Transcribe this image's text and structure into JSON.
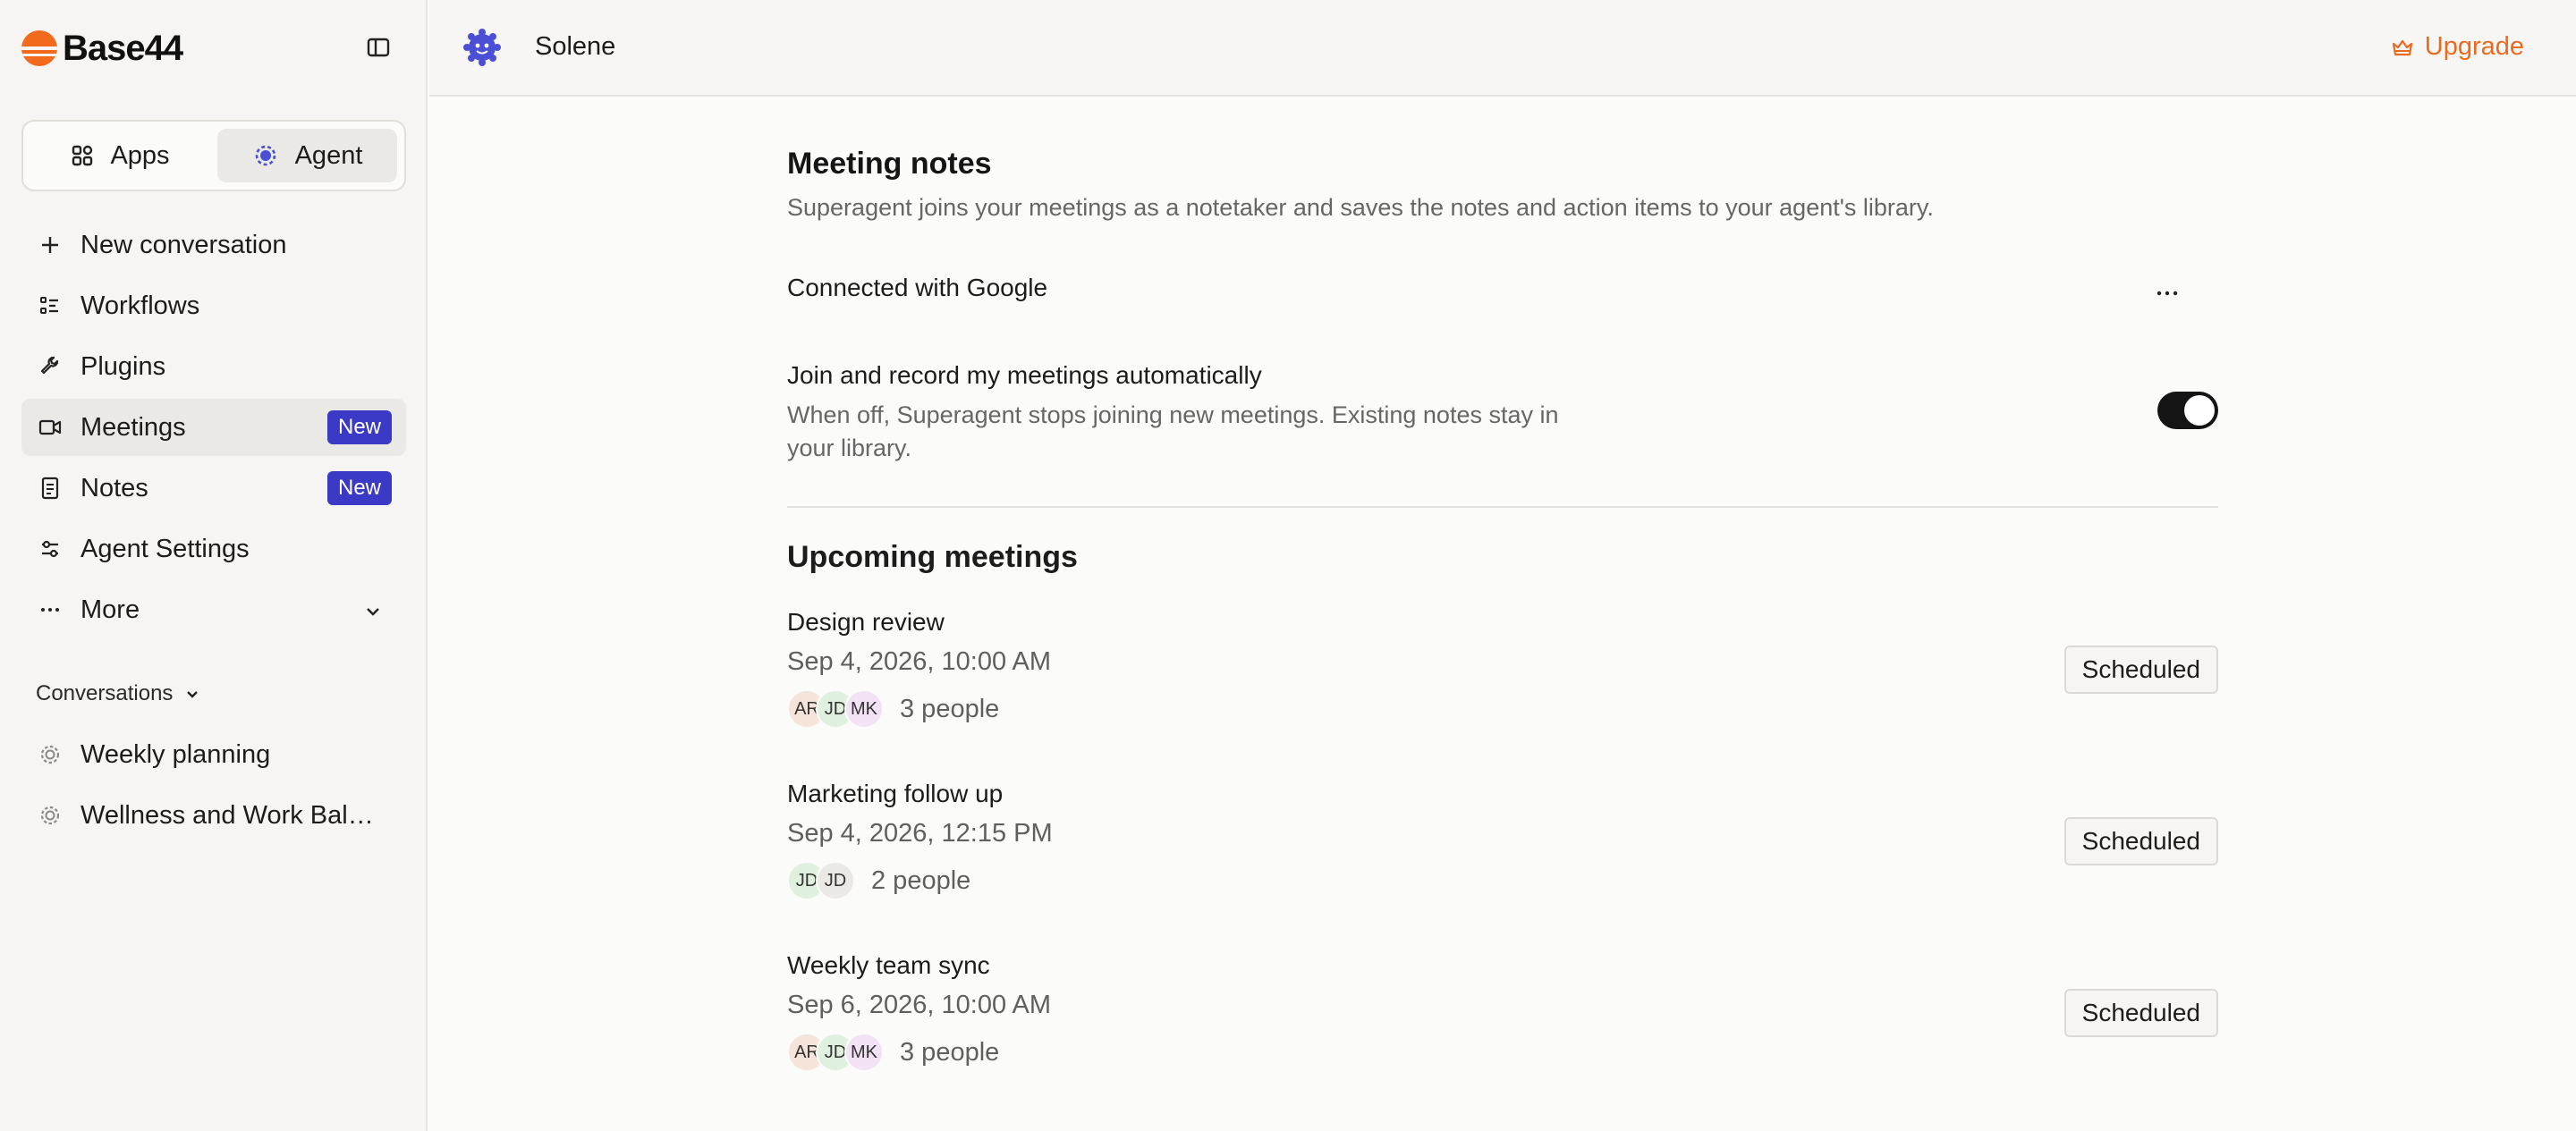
{
  "brand": {
    "name": "Base44",
    "accent": "#f26b1d"
  },
  "switcher": {
    "apps_label": "Apps",
    "agent_label": "Agent"
  },
  "nav": {
    "items": [
      {
        "label": "New conversation",
        "icon": "plus-icon"
      },
      {
        "label": "Workflows",
        "icon": "workflows-icon"
      },
      {
        "label": "Plugins",
        "icon": "wrench-icon"
      },
      {
        "label": "Meetings",
        "icon": "video-icon",
        "badge": "New",
        "active": true
      },
      {
        "label": "Notes",
        "icon": "document-icon",
        "badge": "New"
      },
      {
        "label": "Agent Settings",
        "icon": "sliders-icon"
      },
      {
        "label": "More",
        "icon": "ellipsis-icon"
      }
    ]
  },
  "conversations": {
    "heading": "Conversations",
    "items": [
      {
        "label": "Weekly planning"
      },
      {
        "label": "Wellness and Work Bala…"
      }
    ]
  },
  "header": {
    "agent_name": "Solene",
    "upgrade_label": "Upgrade",
    "upgrade_color": "#ea6a1e"
  },
  "meeting_notes": {
    "title": "Meeting notes",
    "subtitle": "Superagent joins your meetings as a notetaker and saves the notes and action items to your agent's library.",
    "connection": "Connected with Google",
    "auto_join_title": "Join and record my meetings automatically",
    "auto_join_description": "When off, Superagent stops joining new meetings. Existing notes stay in your library.",
    "auto_join_enabled": true
  },
  "upcoming": {
    "title": "Upcoming meetings",
    "meetings": [
      {
        "title": "Design review",
        "date": "Sep 4, 2026, 10:00 AM",
        "avatars": [
          "AR",
          "JD",
          "MK"
        ],
        "people": "3 people",
        "status": "Scheduled"
      },
      {
        "title": "Marketing follow up",
        "date": "Sep 4, 2026, 12:15 PM",
        "avatars": [
          "JD",
          "JD"
        ],
        "people": "2 people",
        "status": "Scheduled"
      },
      {
        "title": "Weekly team sync",
        "date": "Sep 6, 2026, 10:00 AM",
        "avatars": [
          "AR",
          "JD",
          "MK"
        ],
        "people": "3 people",
        "status": "Scheduled"
      }
    ]
  }
}
